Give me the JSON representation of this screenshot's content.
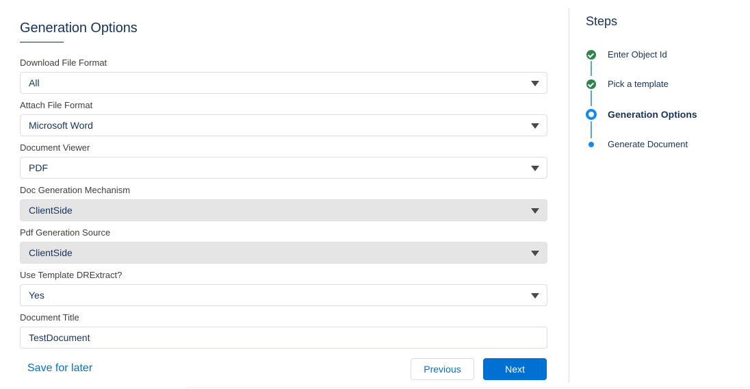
{
  "form": {
    "title": "Generation Options",
    "fields": [
      {
        "label": "Download File Format",
        "value": "All",
        "type": "select",
        "disabled": false
      },
      {
        "label": "Attach File Format",
        "value": "Microsoft Word",
        "type": "select",
        "disabled": false
      },
      {
        "label": "Document Viewer",
        "value": "PDF",
        "type": "select",
        "disabled": false
      },
      {
        "label": "Doc Generation Mechanism",
        "value": "ClientSide",
        "type": "select",
        "disabled": true
      },
      {
        "label": "Pdf Generation Source",
        "value": "ClientSide",
        "type": "select",
        "disabled": true
      },
      {
        "label": "Use Template DRExtract?",
        "value": "Yes",
        "type": "select",
        "disabled": false
      },
      {
        "label": "Document Title",
        "value": "TestDocument",
        "type": "text",
        "disabled": false
      }
    ]
  },
  "actions": {
    "save_later": "Save for later",
    "previous": "Previous",
    "next": "Next"
  },
  "steps": {
    "title": "Steps",
    "items": [
      {
        "label": "Enter Object Id",
        "status": "complete",
        "icon": "check-icon"
      },
      {
        "label": "Pick a template",
        "status": "complete",
        "icon": "check-icon"
      },
      {
        "label": "Generation Options",
        "status": "current",
        "icon": "current-step-icon"
      },
      {
        "label": "Generate Document",
        "status": "upcoming",
        "icon": "upcoming-step-icon"
      }
    ]
  },
  "colors": {
    "brand": "#0070d2",
    "complete": "#2e844a",
    "step_accent": "#1589ee",
    "text": "#16325c",
    "disabled_bg": "#e5e5e5"
  }
}
